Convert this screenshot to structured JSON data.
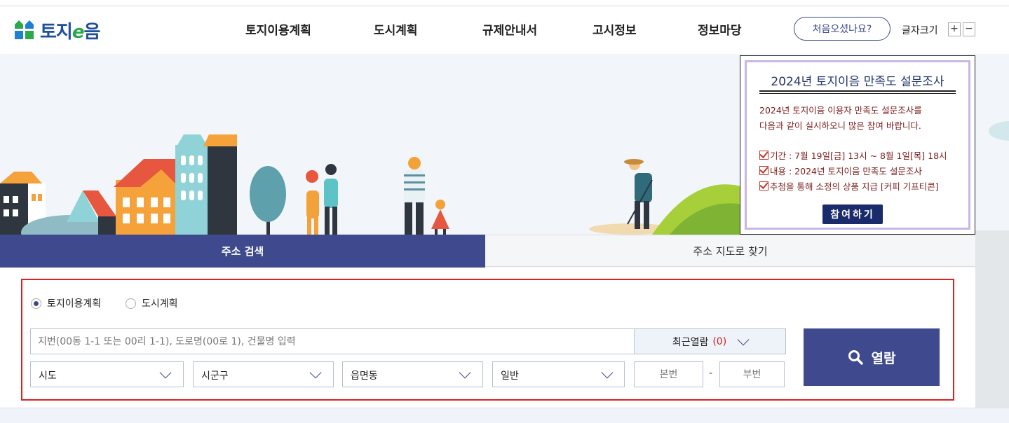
{
  "logo": {
    "text_main": "토지",
    "text_e": "e",
    "text_end": "음"
  },
  "nav": {
    "items": [
      "토지이용계획",
      "도시계획",
      "규제안내서",
      "고시정보",
      "정보마당"
    ]
  },
  "header": {
    "first_visit": "처음오셨나요?",
    "font_size_label": "글자크기",
    "plus": "+",
    "minus": "−"
  },
  "popup": {
    "title": "2024년 토지이음 만족도 설문조사",
    "intro_line1": "2024년 토지이음 이용자 만족도 설문조사를",
    "intro_line2": "다음과 같이 실시하오니 많은 참여 바랍니다.",
    "item1": "기간 : 7월 19일[금] 13시 ~ 8월 1일[목] 18시",
    "item2": "내용 : 2024년 토지이음 만족도 설문조사",
    "item3": "추첨을 통해 소정의 상품 지급 [커피 기프티콘]",
    "join_button": "참여하기"
  },
  "tabs": {
    "address_search": "주소 검색",
    "map_search": "주소 지도로 찾기"
  },
  "search": {
    "radio_land": "토지이용계획",
    "radio_city": "도시계획",
    "placeholder": "지번(00동 1-1 또는 00리 1-1), 도로명(00로 1), 건물명 입력",
    "recent_label": "최근열람",
    "recent_count": "(0)",
    "sido": "시도",
    "sigungu": "시군구",
    "eupmyeondong": "읍면동",
    "land_type": "일반",
    "main_no_placeholder": "본번",
    "dash": "-",
    "sub_no_placeholder": "부번",
    "view_button": "열람"
  },
  "colors": {
    "primary": "#3f4a8e",
    "highlight": "#e02020",
    "popup_button": "#1a2b6b"
  }
}
